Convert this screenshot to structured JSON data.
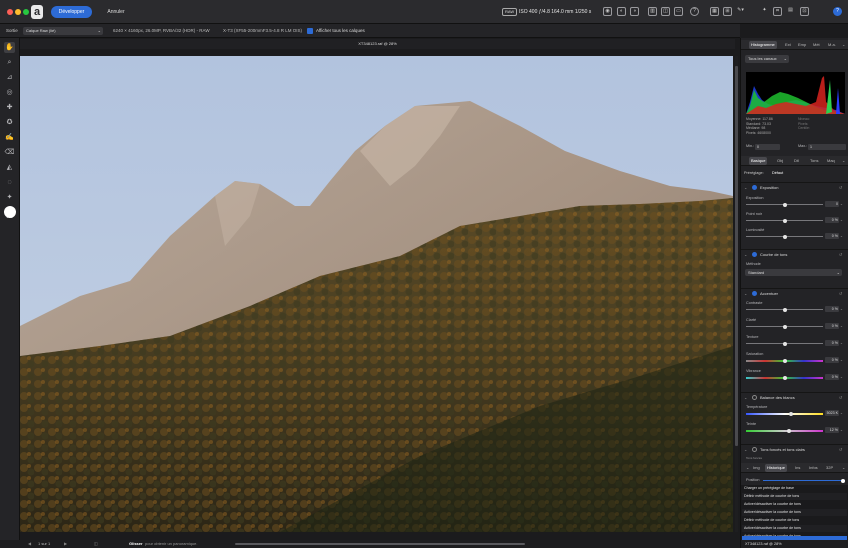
{
  "titlebar": {
    "develop_label": "Développer",
    "cancel_label": "Annuler",
    "raw_badge": "RAW",
    "exif": "ISO 400 ƒ/4.8 164.0 mm 1/250 s",
    "help": "?"
  },
  "context": {
    "output_label": "Sortie",
    "output_value": "Calque Raw (lié)",
    "image_info": "6240 × 4160px, 26.0MP, RVBA/32 (HDR) - RAW",
    "lens_info": "X-T3 (XF55-200mmF3.5-4.8 R LM OIS)",
    "show_layers_label": "Afficher tous les calques"
  },
  "document": {
    "title": "XT348123.raf @ 28%"
  },
  "status": {
    "pages": "1 sur 1",
    "hint_bold": "Glisser",
    "hint_text": "pour obtenir un panoramique."
  },
  "panel": {
    "top_tabs": [
      "Histogramme",
      "Ext",
      "Emp",
      "Mét",
      "M.a."
    ],
    "channel": "Tous les canaux",
    "stats_left": [
      "Moyenne: 117.86",
      "Standard: 73.03",
      "Médiane: 98",
      "Pixels: 4608000"
    ],
    "stats_right": [
      "Niveau:",
      "Pixels:",
      "Centile:"
    ],
    "min_label": "Min.:",
    "min_value": "0",
    "max_label": "Max.:",
    "max_value": "1",
    "adj_tabs": [
      "Basique",
      "Obj",
      "Dtl",
      "Tons",
      "Maq"
    ],
    "preset_label": "Préréglage:",
    "preset_value": "Défaut",
    "exposure": {
      "title": "Exposition",
      "rows": [
        {
          "label": "Exposition",
          "value": "0",
          "pos": 0.5
        },
        {
          "label": "Point noir",
          "value": "0 %",
          "pos": 0.5
        },
        {
          "label": "Luminosité",
          "value": "0 %",
          "pos": 0.5
        }
      ]
    },
    "tone_curve": {
      "title": "Courbe de tons",
      "method_label": "Méthode",
      "method_value": "Standard"
    },
    "enhance": {
      "title": "Accentuer",
      "rows": [
        {
          "label": "Contraste",
          "value": "0 %",
          "pos": 0.5
        },
        {
          "label": "Clarté",
          "value": "0 %",
          "pos": 0.5
        },
        {
          "label": "Texture",
          "value": "0 %",
          "pos": 0.5
        },
        {
          "label": "Saturation",
          "value": "0 %",
          "pos": 0.5
        },
        {
          "label": "Vibrance",
          "value": "0 %",
          "pos": 0.5
        }
      ]
    },
    "white_balance": {
      "title": "Balance des blancs",
      "rows": [
        {
          "label": "Température",
          "value": "5023 K",
          "pos": 0.58
        },
        {
          "label": "Teinte",
          "value": "12 %",
          "pos": 0.56
        }
      ]
    },
    "shadows_highlights": {
      "title": "Tons foncés et tons clairs",
      "sub_label": "Tons foncés"
    },
    "bottom_tabs": [
      "Img",
      "Historique",
      "Ins",
      "Infos",
      "32P"
    ],
    "history_position_label": "Position",
    "history": [
      "Charger un préréglage de base",
      "Définir méthode de courbe de tons",
      "Activer/désactiver la courbe de tons",
      "Activer/désactiver la courbe de tons",
      "Définir méthode de courbe de tons",
      "Activer/désactiver la courbe de tons",
      "Activer/désactiver la courbe de tons"
    ],
    "footer_title": "XT348123.raf @ 28%"
  }
}
